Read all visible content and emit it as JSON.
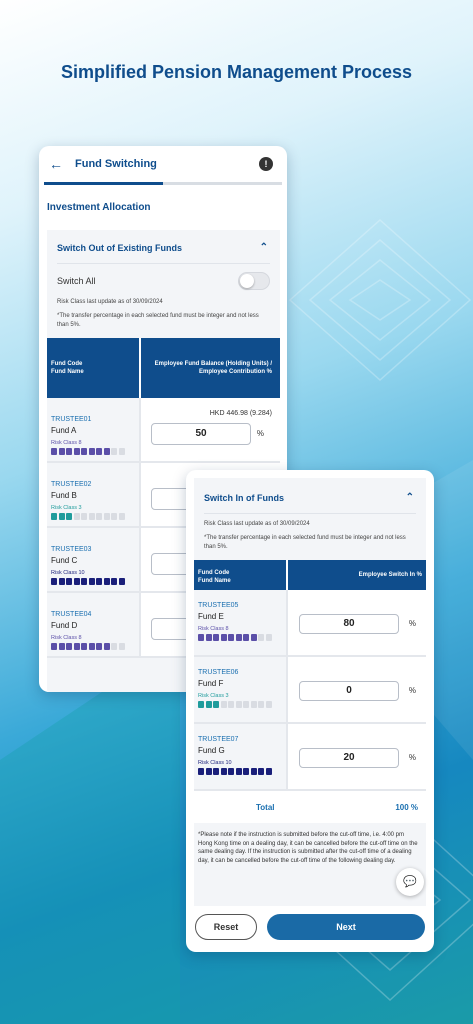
{
  "headline": "Simplified Pension Management Process",
  "colors": {
    "primary": "#0f4d8c",
    "link": "#1a6fb0",
    "risk_purple": "#5b4fa8",
    "risk_teal": "#1f9c9c",
    "risk_navy": "#1a1f7a"
  },
  "screen1": {
    "title": "Fund Switching",
    "section": "Investment Allocation",
    "panel_title": "Switch Out of Existing Funds",
    "switch_all": "Switch All",
    "risk_update": "Risk Class last update as of 30/09/2024",
    "note": "*The transfer percentage in each selected fund must be integer and not less than 5%.",
    "col_left_1": "Fund Code",
    "col_left_2": "Fund Name",
    "col_right": "Employee Fund Balance (Holding Units) / Employee Contribution %",
    "funds": [
      {
        "code": "TRUSTEE01",
        "name": "Fund A",
        "risk": "Risk Class 8",
        "risk_level": 8,
        "balance": "HKD 446.98 (9.284)",
        "value": "50",
        "unit": "%"
      },
      {
        "code": "TRUSTEE02",
        "name": "Fund B",
        "risk": "Risk Class 3",
        "risk_level": 3
      },
      {
        "code": "TRUSTEE03",
        "name": "Fund C",
        "risk": "Risk Class 10",
        "risk_level": 10
      },
      {
        "code": "TRUSTEE04",
        "name": "Fund D",
        "risk": "Risk Class 8",
        "risk_level": 8
      }
    ]
  },
  "screen2": {
    "panel_title": "Switch In of Funds",
    "risk_update": "Risk Class last update as of 30/09/2024",
    "note": "*The transfer percentage in each selected fund must be integer and not less than 5%.",
    "col_left_1": "Fund Code",
    "col_left_2": "Fund Name",
    "col_right": "Employee Switch In %",
    "funds": [
      {
        "code": "TRUSTEE05",
        "name": "Fund E",
        "risk": "Risk Class 8",
        "risk_level": 8,
        "value": "80",
        "unit": "%"
      },
      {
        "code": "TRUSTEE06",
        "name": "Fund F",
        "risk": "Risk Class 3",
        "risk_level": 3,
        "value": "0",
        "unit": "%"
      },
      {
        "code": "TRUSTEE07",
        "name": "Fund G",
        "risk": "Risk Class 10",
        "risk_level": 10,
        "value": "20",
        "unit": "%"
      }
    ],
    "total_label": "Total",
    "total_value": "100 %",
    "disclaimer": "*Please note if the instruction is submitted before the cut-off time, i.e. 4:00 pm Hong Kong time on a dealing day, it can be cancelled before the cut-off time on the same dealing day. If the instruction is submitted after the cut-off time of a dealing day, it can be cancelled before the cut-off time of the following dealing day.",
    "reset": "Reset",
    "next": "Next"
  }
}
